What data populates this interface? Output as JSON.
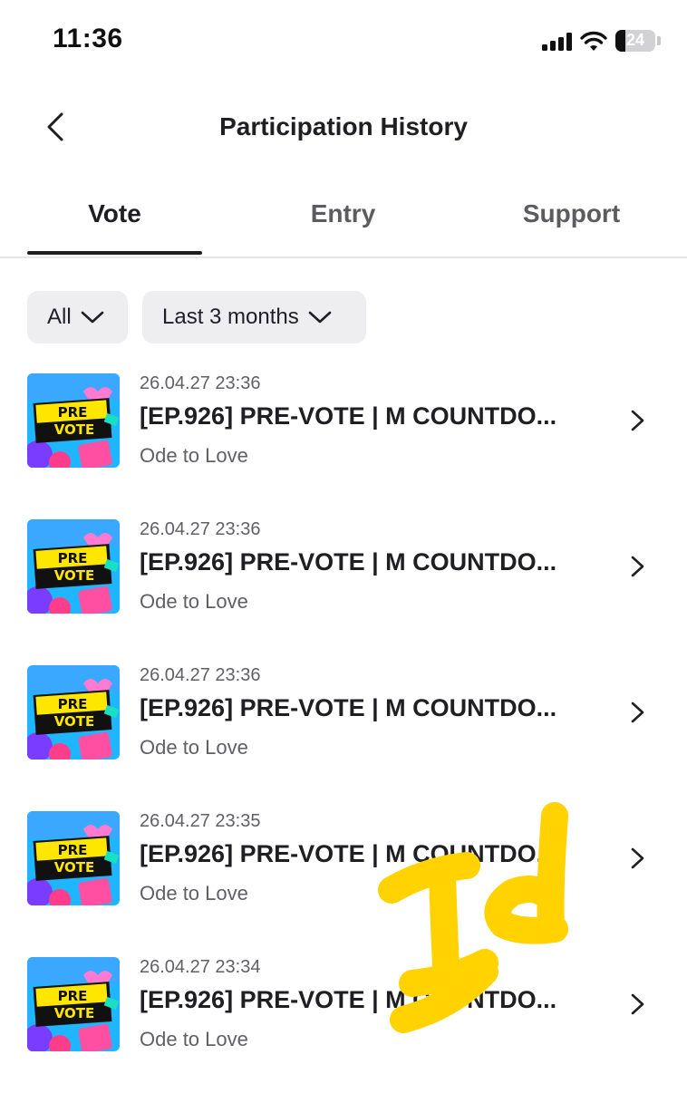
{
  "status_bar": {
    "time": "11:36",
    "battery": "24"
  },
  "header": {
    "title": "Participation History"
  },
  "tabs": [
    {
      "label": "Vote",
      "active": true
    },
    {
      "label": "Entry",
      "active": false
    },
    {
      "label": "Support",
      "active": false
    }
  ],
  "filters": {
    "type": "All",
    "period": "Last 3 months"
  },
  "thumbnail": {
    "line1": "PRE",
    "line2": "VOTE"
  },
  "items": [
    {
      "date": "26.04.27 23:36",
      "title": "[EP.926] PRE-VOTE | M COUNTDO...",
      "subtitle": "Ode to Love"
    },
    {
      "date": "26.04.27 23:36",
      "title": "[EP.926] PRE-VOTE | M COUNTDO...",
      "subtitle": "Ode to Love"
    },
    {
      "date": "26.04.27 23:36",
      "title": "[EP.926] PRE-VOTE | M COUNTDO...",
      "subtitle": "Ode to Love"
    },
    {
      "date": "26.04.27 23:35",
      "title": "[EP.926] PRE-VOTE | M COUNTDO...",
      "subtitle": "Ode to Love"
    },
    {
      "date": "26.04.27 23:34",
      "title": "[EP.926] PRE-VOTE | M COUNTDO...",
      "subtitle": "Ode to Love"
    }
  ],
  "colors": {
    "accent": "#1f1f23",
    "chip_bg": "#eeeef0",
    "scribble": "#ffd200"
  }
}
